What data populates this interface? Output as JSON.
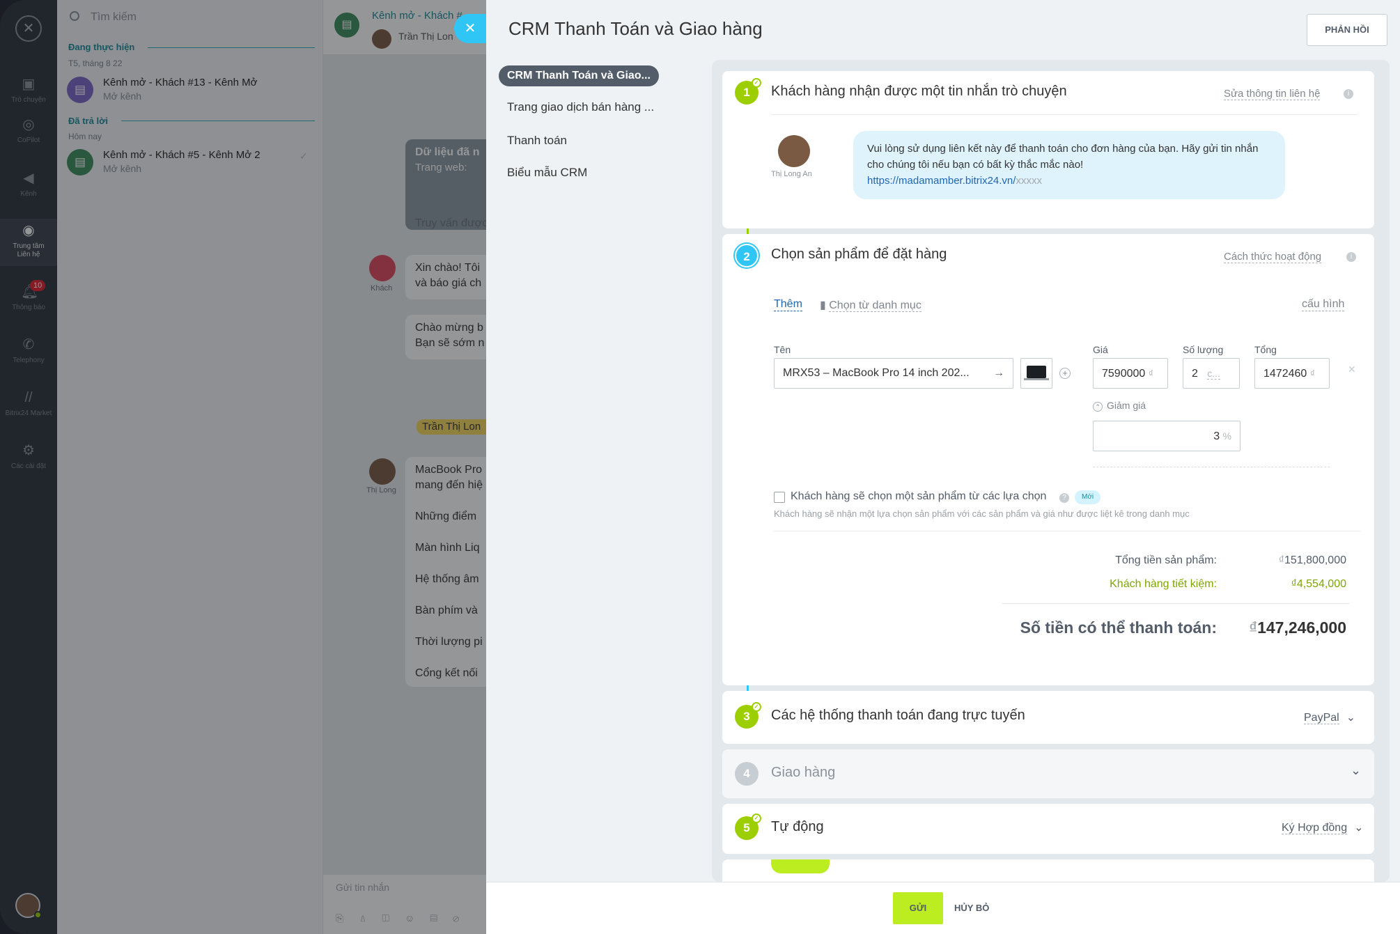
{
  "rail": {
    "close": "✕",
    "items": [
      {
        "label": "Trò chuyện",
        "icon": "chat-icon"
      },
      {
        "label": "CoPilot",
        "icon": "copilot-icon"
      },
      {
        "label": "Kênh",
        "icon": "megaphone-icon"
      },
      {
        "label": "Trung tâm Liên hệ",
        "icon": "contact-center-icon"
      },
      {
        "label": "Thông báo",
        "icon": "bell-icon",
        "badge": "10"
      },
      {
        "label": "Telephony",
        "icon": "phone-icon"
      },
      {
        "label": "Bitrix24 Market",
        "icon": "market-icon"
      },
      {
        "label": "Các cài đặt",
        "icon": "gear-icon"
      }
    ]
  },
  "chatlist": {
    "search_placeholder": "Tìm kiếm",
    "group_active": "Đang thực hiện",
    "group_active_date": "T5, tháng 8 22",
    "group_answered": "Đã trả lời",
    "group_answered_date": "Hôm nay",
    "items": [
      {
        "title": "Kênh mở - Khách #13 - Kênh Mở",
        "subtitle": "Mở kênh",
        "color": "#7a67c7"
      },
      {
        "title": "Kênh mở - Khách #5 - Kênh Mở 2",
        "subtitle": "Mở kênh",
        "color": "#3c8e5b",
        "mark": "✓"
      }
    ]
  },
  "chatwin": {
    "header_title": "Kênh mở - Khách #",
    "header_sub": "Trần Thị Lon",
    "system_title": "Dữ liệu đã n",
    "system_sub": "Trang web:",
    "query_text": "Truy vấn được",
    "guest_label": "Khách",
    "guest_msg_1": "Xin chào! Tôi",
    "guest_msg_2": "và báo giá ch",
    "welcome_1": "Chào mừng b",
    "welcome_2": "Bạn sẽ sớm n",
    "agent_tag": "Trần Thị Lon",
    "agent_label": "Thị Long",
    "agent_lines": [
      "MacBook Pro",
      "mang đến hiệ",
      "Những điểm",
      "Màn hình Liq",
      "Hệ thống âm",
      "Bàn phím và",
      "Thời lượng pi",
      "Cổng kết nối"
    ],
    "input_placeholder": "Gửi tin nhắn"
  },
  "panel": {
    "title": "CRM Thanh Toán và Giao hàng",
    "feedback": "PHẢN HỒI",
    "nav": [
      "CRM Thanh Toán và Giao...",
      "Trang giao dịch bán hàng ...",
      "Thanh toán",
      "Biểu mẫu CRM"
    ],
    "step1": {
      "num": "1",
      "title": "Khách hàng nhận được một tin nhắn trò chuyện",
      "right": "Sửa thông tin liên hệ",
      "avatar_label": "Thị Long An",
      "message": "Vui lòng sử dụng liên kết này để thanh toán cho đơn hàng của bạn. Hãy gửi tin nhắn cho chúng tôi nếu bạn có bất kỳ thắc mắc nào!",
      "link": "https://madamamber.bitrix24.vn/",
      "link_suffix": "xxxxx"
    },
    "step2": {
      "num": "2",
      "title": "Chọn sản phẩm để đặt hàng",
      "right": "Cách thức hoạt động",
      "add": "Thêm",
      "catalog": "Chọn từ danh mục",
      "config": "cấu hình",
      "col_name": "Tên",
      "col_price": "Giá",
      "col_qty": "Số lượng",
      "col_total": "Tổng",
      "product_name": "MRX53 – MacBook Pro 14 inch 202...",
      "price": "7590000",
      "price_unit": "₫",
      "qty": "2",
      "qty_unit": "c...",
      "total": "1472460",
      "total_unit": "₫",
      "discount_label": "Giảm giá",
      "discount_value": "3",
      "discount_unit": "%",
      "choose_label": "Khách hàng sẽ chọn một sản phẩm từ các lựa chọn",
      "new_badge": "Mới",
      "choose_hint": "Khách hàng sẽ nhận một lựa chọn sản phẩm với các sản phẩm và giá như được liệt kê trong danh mục",
      "sum_products_label": "Tổng tiền sản phẩm:",
      "sum_products_cur": "₫",
      "sum_products": "151,800,000",
      "savings_label": "Khách hàng tiết kiệm:",
      "savings_cur": "₫",
      "savings": "4,554,000",
      "payable_label": "Số tiền có thể thanh toán:",
      "payable_cur": "₫",
      "payable": "147,246,000"
    },
    "step3": {
      "num": "3",
      "title": "Các hệ thống thanh toán đang trực tuyến",
      "right": "PayPal"
    },
    "step4": {
      "num": "4",
      "title": "Giao hàng"
    },
    "step5": {
      "num": "5",
      "title": "Tự động",
      "right": "Ký Hợp đồng"
    },
    "send": "GỬI",
    "cancel": "HỦY BỎ"
  },
  "colors": {
    "accent": "#2fc6f6",
    "green": "#9dcf00",
    "send": "#bbed21",
    "dark": "#535c69"
  }
}
